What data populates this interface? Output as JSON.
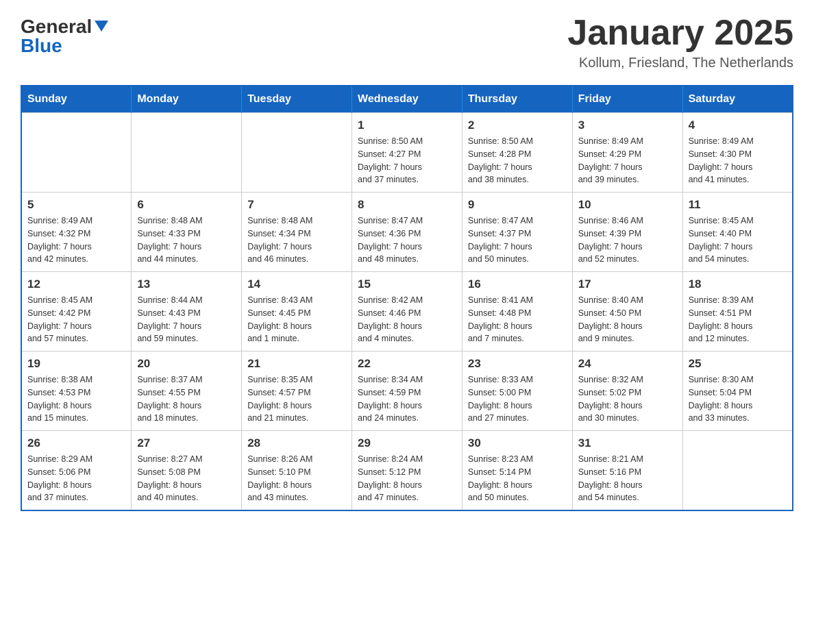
{
  "header": {
    "logo_general": "General",
    "logo_blue": "Blue",
    "month_title": "January 2025",
    "location": "Kollum, Friesland, The Netherlands"
  },
  "weekdays": [
    "Sunday",
    "Monday",
    "Tuesday",
    "Wednesday",
    "Thursday",
    "Friday",
    "Saturday"
  ],
  "weeks": [
    [
      {
        "day": "",
        "info": ""
      },
      {
        "day": "",
        "info": ""
      },
      {
        "day": "",
        "info": ""
      },
      {
        "day": "1",
        "info": "Sunrise: 8:50 AM\nSunset: 4:27 PM\nDaylight: 7 hours\nand 37 minutes."
      },
      {
        "day": "2",
        "info": "Sunrise: 8:50 AM\nSunset: 4:28 PM\nDaylight: 7 hours\nand 38 minutes."
      },
      {
        "day": "3",
        "info": "Sunrise: 8:49 AM\nSunset: 4:29 PM\nDaylight: 7 hours\nand 39 minutes."
      },
      {
        "day": "4",
        "info": "Sunrise: 8:49 AM\nSunset: 4:30 PM\nDaylight: 7 hours\nand 41 minutes."
      }
    ],
    [
      {
        "day": "5",
        "info": "Sunrise: 8:49 AM\nSunset: 4:32 PM\nDaylight: 7 hours\nand 42 minutes."
      },
      {
        "day": "6",
        "info": "Sunrise: 8:48 AM\nSunset: 4:33 PM\nDaylight: 7 hours\nand 44 minutes."
      },
      {
        "day": "7",
        "info": "Sunrise: 8:48 AM\nSunset: 4:34 PM\nDaylight: 7 hours\nand 46 minutes."
      },
      {
        "day": "8",
        "info": "Sunrise: 8:47 AM\nSunset: 4:36 PM\nDaylight: 7 hours\nand 48 minutes."
      },
      {
        "day": "9",
        "info": "Sunrise: 8:47 AM\nSunset: 4:37 PM\nDaylight: 7 hours\nand 50 minutes."
      },
      {
        "day": "10",
        "info": "Sunrise: 8:46 AM\nSunset: 4:39 PM\nDaylight: 7 hours\nand 52 minutes."
      },
      {
        "day": "11",
        "info": "Sunrise: 8:45 AM\nSunset: 4:40 PM\nDaylight: 7 hours\nand 54 minutes."
      }
    ],
    [
      {
        "day": "12",
        "info": "Sunrise: 8:45 AM\nSunset: 4:42 PM\nDaylight: 7 hours\nand 57 minutes."
      },
      {
        "day": "13",
        "info": "Sunrise: 8:44 AM\nSunset: 4:43 PM\nDaylight: 7 hours\nand 59 minutes."
      },
      {
        "day": "14",
        "info": "Sunrise: 8:43 AM\nSunset: 4:45 PM\nDaylight: 8 hours\nand 1 minute."
      },
      {
        "day": "15",
        "info": "Sunrise: 8:42 AM\nSunset: 4:46 PM\nDaylight: 8 hours\nand 4 minutes."
      },
      {
        "day": "16",
        "info": "Sunrise: 8:41 AM\nSunset: 4:48 PM\nDaylight: 8 hours\nand 7 minutes."
      },
      {
        "day": "17",
        "info": "Sunrise: 8:40 AM\nSunset: 4:50 PM\nDaylight: 8 hours\nand 9 minutes."
      },
      {
        "day": "18",
        "info": "Sunrise: 8:39 AM\nSunset: 4:51 PM\nDaylight: 8 hours\nand 12 minutes."
      }
    ],
    [
      {
        "day": "19",
        "info": "Sunrise: 8:38 AM\nSunset: 4:53 PM\nDaylight: 8 hours\nand 15 minutes."
      },
      {
        "day": "20",
        "info": "Sunrise: 8:37 AM\nSunset: 4:55 PM\nDaylight: 8 hours\nand 18 minutes."
      },
      {
        "day": "21",
        "info": "Sunrise: 8:35 AM\nSunset: 4:57 PM\nDaylight: 8 hours\nand 21 minutes."
      },
      {
        "day": "22",
        "info": "Sunrise: 8:34 AM\nSunset: 4:59 PM\nDaylight: 8 hours\nand 24 minutes."
      },
      {
        "day": "23",
        "info": "Sunrise: 8:33 AM\nSunset: 5:00 PM\nDaylight: 8 hours\nand 27 minutes."
      },
      {
        "day": "24",
        "info": "Sunrise: 8:32 AM\nSunset: 5:02 PM\nDaylight: 8 hours\nand 30 minutes."
      },
      {
        "day": "25",
        "info": "Sunrise: 8:30 AM\nSunset: 5:04 PM\nDaylight: 8 hours\nand 33 minutes."
      }
    ],
    [
      {
        "day": "26",
        "info": "Sunrise: 8:29 AM\nSunset: 5:06 PM\nDaylight: 8 hours\nand 37 minutes."
      },
      {
        "day": "27",
        "info": "Sunrise: 8:27 AM\nSunset: 5:08 PM\nDaylight: 8 hours\nand 40 minutes."
      },
      {
        "day": "28",
        "info": "Sunrise: 8:26 AM\nSunset: 5:10 PM\nDaylight: 8 hours\nand 43 minutes."
      },
      {
        "day": "29",
        "info": "Sunrise: 8:24 AM\nSunset: 5:12 PM\nDaylight: 8 hours\nand 47 minutes."
      },
      {
        "day": "30",
        "info": "Sunrise: 8:23 AM\nSunset: 5:14 PM\nDaylight: 8 hours\nand 50 minutes."
      },
      {
        "day": "31",
        "info": "Sunrise: 8:21 AM\nSunset: 5:16 PM\nDaylight: 8 hours\nand 54 minutes."
      },
      {
        "day": "",
        "info": ""
      }
    ]
  ]
}
